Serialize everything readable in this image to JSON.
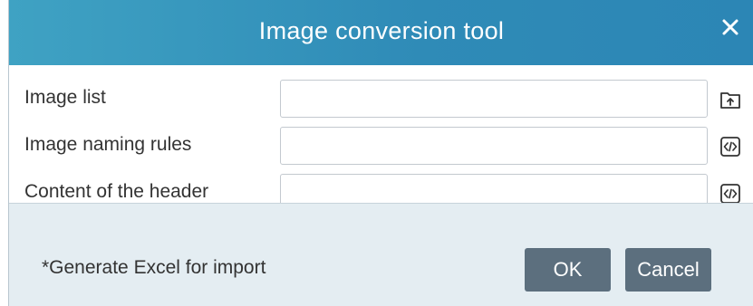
{
  "dialog": {
    "title": "Image conversion tool",
    "close_icon": "close-icon"
  },
  "fields": [
    {
      "label": "Image list",
      "value": "",
      "icon": "folder-upload-icon"
    },
    {
      "label": "Image naming rules",
      "value": "",
      "icon": "code-icon"
    },
    {
      "label": "Content of the header",
      "value": "",
      "icon": "code-icon"
    }
  ],
  "footer": {
    "note": "*Generate Excel for import",
    "ok_label": "OK",
    "cancel_label": "Cancel"
  },
  "colors": {
    "titlebar": "#2f8bb7",
    "footer_bg": "#e4edf2",
    "button_bg": "#5c6f7e"
  }
}
